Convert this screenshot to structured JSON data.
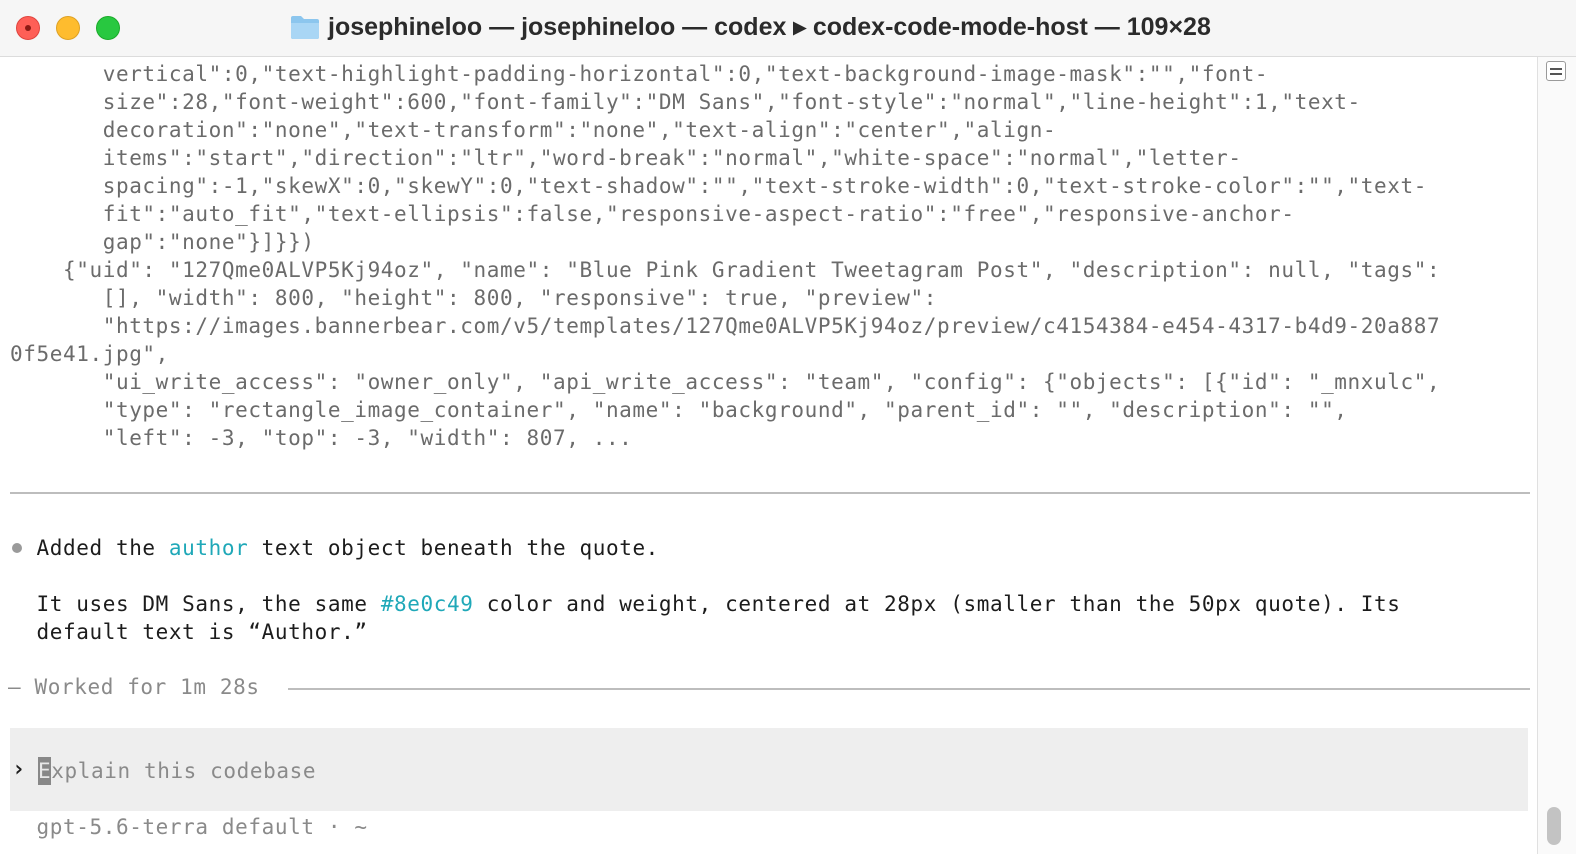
{
  "window": {
    "title": "josephineloo — josephineloo — codex ▸ codex-code-mode-host — 109×28"
  },
  "output": {
    "lines": [
      "       vertical\":0,\"text-highlight-padding-horizontal\":0,\"text-background-image-mask\":\"\",\"font-",
      "       size\":28,\"font-weight\":600,\"font-family\":\"DM Sans\",\"font-style\":\"normal\",\"line-height\":1,\"text-",
      "       decoration\":\"none\",\"text-transform\":\"none\",\"text-align\":\"center\",\"align-",
      "       items\":\"start\",\"direction\":\"ltr\",\"word-break\":\"normal\",\"white-space\":\"normal\",\"letter-",
      "       spacing\":-1,\"skewX\":0,\"skewY\":0,\"text-shadow\":\"\",\"text-stroke-width\":0,\"text-stroke-color\":\"\",\"text-",
      "       fit\":\"auto_fit\",\"text-ellipsis\":false,\"responsive-aspect-ratio\":\"free\",\"responsive-anchor-",
      "       gap\":\"none\"}]}})",
      "    {\"uid\": \"127Qme0ALVP5Kj94oz\", \"name\": \"Blue Pink Gradient Tweetagram Post\", \"description\": null, \"tags\":",
      "       [], \"width\": 800, \"height\": 800, \"responsive\": true, \"preview\":",
      "       \"https://images.bannerbear.com/v5/templates/127Qme0ALVP5Kj94oz/preview/c4154384-e454-4317-b4d9-20a887",
      "0f5e41.jpg\",",
      "       \"ui_write_access\": \"owner_only\", \"api_write_access\": \"team\", \"config\": {\"objects\": [{\"id\": \"_mnxulc\",",
      "       \"type\": \"rectangle_image_container\", \"name\": \"background\", \"parent_id\": \"\", \"description\": \"\",",
      "       \"left\": -3, \"top\": -3, \"width\": 807, ..."
    ]
  },
  "message": {
    "line1_a": "  Added the ",
    "line1_author": "author",
    "line1_b": " text object beneath the quote.",
    "line2_a": "  It uses DM Sans, the same ",
    "line2_color": "#8e0c49",
    "line2_b": " color and weight, centered at 28px (smaller than the 50px quote). Its",
    "line3": "  default text is “Author.”"
  },
  "status": {
    "worked": "— Worked for 1m 28s"
  },
  "composer": {
    "prompt_symbol": "›",
    "cursor_char": "E",
    "placeholder_rest": "xplain this codebase"
  },
  "footer": {
    "model_info": "  gpt-5.6-terra default · ~"
  },
  "colors": {
    "accent": "#1fa8b8"
  }
}
